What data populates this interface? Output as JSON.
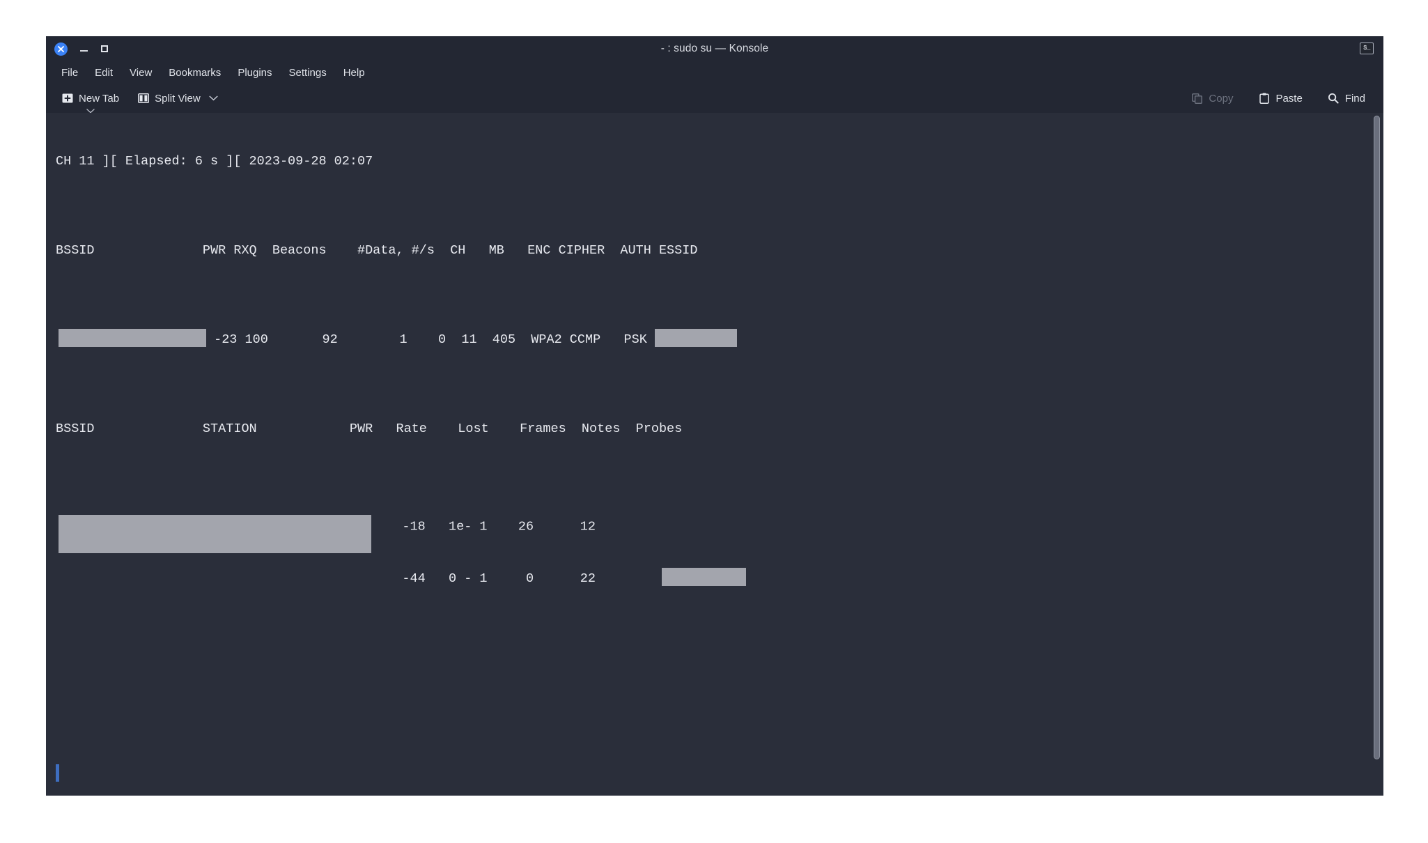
{
  "window": {
    "title": "- : sudo su — Konsole",
    "controls": {
      "close": "close-window",
      "minimize": "minimize-window",
      "maximize": "maximize-window"
    },
    "profile_badge": "$_"
  },
  "menubar": {
    "items": [
      {
        "label": "File"
      },
      {
        "label": "Edit"
      },
      {
        "label": "View"
      },
      {
        "label": "Bookmarks"
      },
      {
        "label": "Plugins"
      },
      {
        "label": "Settings"
      },
      {
        "label": "Help"
      }
    ]
  },
  "toolbar": {
    "new_tab_label": "New Tab",
    "split_view_label": "Split View",
    "copy_label": "Copy",
    "copy_enabled": false,
    "paste_label": "Paste",
    "find_label": "Find"
  },
  "terminal": {
    "status_line": "CH 11 ][ Elapsed: 6 s ][ 2023-09-28 02:07",
    "ap_header": "BSSID              PWR RXQ  Beacons    #Data, #/s  CH   MB   ENC CIPHER  AUTH ESSID",
    "ap_row": {
      "bssid": "[REDACTED]",
      "pwr": "-23",
      "rxq": "100",
      "beacons": "92",
      "data": "1",
      "per_sec": "0",
      "ch": "11",
      "mb": "405",
      "enc": "WPA2",
      "cipher": "CCMP",
      "auth": "PSK",
      "essid": "[REDACTED]",
      "line_prefix": "             ",
      "line_values": " -23 100       92        1    0  11  405  WPA2 CCMP   PSK "
    },
    "station_header": "BSSID              STATION            PWR   Rate    Lost    Frames  Notes  Probes",
    "station_rows": [
      {
        "bssid": "[REDACTED]",
        "station": "[REDACTED]",
        "pwr": "-18",
        "rate": "1e- 1",
        "lost": "26",
        "frames": "12",
        "notes": "",
        "probes": "",
        "values_line": "    -18   1e- 1    26      12"
      },
      {
        "bssid": "[REDACTED]",
        "station": "[REDACTED]",
        "pwr": "-44",
        "rate": "0 - 1",
        "lost": "0",
        "frames": "22",
        "notes": "",
        "probes": "[REDACTED]",
        "values_line": "    -44   0 - 1     0      22"
      }
    ],
    "cursor": "block-cursor"
  },
  "colors": {
    "window_chrome": "#232733",
    "terminal_bg": "#2a2e3a",
    "terminal_fg": "#e8eaf0",
    "accent": "#3b82f6",
    "cursor": "#3e6ec0",
    "redaction": "#a3a5ad",
    "disabled_text": "#6e7380"
  }
}
